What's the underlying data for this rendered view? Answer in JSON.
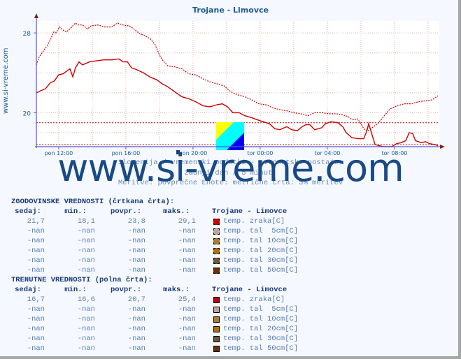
{
  "title": "Trojane - Limovce",
  "side_url": "www.si-vreme.com",
  "watermark": "www.si-vreme.com",
  "captions": [
    "Slovenija / vremenski podatki - avtomatske postaje.",
    "zadnji dan / 5 minut.",
    "Meritve: povprečne  Enote: metrične  Črta: 5% meritev"
  ],
  "chart_data": {
    "type": "line",
    "title": "Trojane - Limovce",
    "xlabel": "",
    "ylabel": "",
    "x_unit": "hours since pon 10:40",
    "xlim": [
      0,
      24
    ],
    "ylim": [
      16.6,
      29.2
    ],
    "yticks": [
      20,
      28
    ],
    "ytick_labels": [
      "20",
      "28"
    ],
    "xticks": [
      1.33,
      5.33,
      9.33,
      13.33,
      17.33,
      21.33
    ],
    "xtick_labels": [
      "pon 12:00",
      "pon 16:00",
      "pon 20:00",
      "tor 00:00",
      "tor 04:00",
      "tor 08:00"
    ],
    "grid": true,
    "reference_lines": [
      {
        "name": "historical max 5%",
        "y": 19.0
      },
      {
        "name": "current min",
        "y": 16.8
      }
    ],
    "series": [
      {
        "name": "temp. zraka[C] (zgodovinske, črtkana)",
        "style": "dashed",
        "color": "#cc0000",
        "x": [
          0,
          0.17,
          0.42,
          0.63,
          0.83,
          1.04,
          1.17,
          1.38,
          1.58,
          1.79,
          2.0,
          2.33,
          2.5,
          2.75,
          3.04,
          3.25,
          3.67,
          4.08,
          4.5,
          4.83,
          5.13,
          5.54,
          5.88,
          6.17,
          6.38,
          6.79,
          7.08,
          7.33,
          7.5,
          7.83,
          8.25,
          8.67,
          9.08,
          9.5,
          9.92,
          10.33,
          10.75,
          11.17,
          11.58,
          12.0,
          12.42,
          12.83,
          13.25,
          13.67,
          14.08,
          14.5,
          14.92,
          15.33,
          15.75,
          16.17,
          16.58,
          17.0,
          17.42,
          17.83,
          18.25,
          18.58,
          18.71,
          18.92,
          19.13,
          19.33,
          19.54,
          19.79,
          20.0,
          20.33,
          20.67,
          21.08,
          21.5,
          21.92,
          22.33,
          22.75,
          23.17,
          23.58,
          23.92
        ],
        "y": [
          24.8,
          25.6,
          26.2,
          26.7,
          27.3,
          28.1,
          28.0,
          28.6,
          28.3,
          28.1,
          28.4,
          29.0,
          28.8,
          28.8,
          28.4,
          28.7,
          28.8,
          28.6,
          28.6,
          29.0,
          28.8,
          28.7,
          28.3,
          27.9,
          27.8,
          27.4,
          26.8,
          25.8,
          25.3,
          24.7,
          24.6,
          24.4,
          23.9,
          23.8,
          23.4,
          23.1,
          22.9,
          22.7,
          22.1,
          21.8,
          21.6,
          21.3,
          20.9,
          20.8,
          20.5,
          20.3,
          20.2,
          20.0,
          19.9,
          19.7,
          20.0,
          20.0,
          19.9,
          19.9,
          19.8,
          19.6,
          19.4,
          19.3,
          19.4,
          18.9,
          18.3,
          18.2,
          18.5,
          18.9,
          19.6,
          20.4,
          20.7,
          20.9,
          20.9,
          21.1,
          21.2,
          21.3,
          21.7
        ]
      },
      {
        "name": "temp. zraka[C] (trenutne, polna)",
        "style": "solid",
        "color": "#cc0000",
        "x": [
          0,
          0.25,
          0.54,
          0.83,
          1.08,
          1.33,
          1.58,
          1.83,
          2.0,
          2.17,
          2.33,
          2.54,
          2.75,
          3.17,
          3.58,
          4.0,
          4.5,
          4.92,
          5.17,
          5.42,
          5.67,
          6.0,
          6.38,
          6.75,
          7.17,
          7.5,
          7.83,
          8.33,
          8.67,
          9.08,
          9.5,
          9.92,
          10.33,
          10.75,
          11.08,
          11.38,
          11.71,
          12.08,
          12.42,
          12.83,
          13.33,
          13.88,
          14.21,
          14.5,
          14.92,
          15.21,
          15.54,
          15.83,
          16.04,
          16.29,
          16.58,
          17.0,
          17.21,
          17.54,
          17.96,
          18.25,
          18.46,
          18.79,
          19.17,
          19.5,
          19.71,
          19.79,
          19.96,
          20.17,
          20.67,
          21.17,
          21.46,
          21.71,
          22.0,
          22.21,
          22.42,
          22.58,
          22.92,
          23.17,
          23.42,
          23.75,
          23.92
        ],
        "y": [
          22.0,
          22.2,
          22.4,
          23.0,
          23.2,
          23.8,
          23.9,
          24.2,
          24.4,
          23.6,
          24.5,
          25.1,
          24.8,
          25.1,
          25.2,
          25.3,
          25.3,
          25.4,
          25.1,
          25.1,
          24.5,
          24.3,
          24.0,
          23.6,
          23.3,
          22.9,
          22.6,
          22.0,
          21.6,
          21.4,
          21.1,
          20.7,
          20.6,
          20.8,
          20.9,
          20.6,
          20.0,
          20.0,
          19.7,
          19.5,
          19.2,
          18.9,
          18.4,
          18.3,
          18.6,
          18.3,
          18.2,
          18.6,
          18.8,
          18.8,
          18.3,
          18.5,
          18.9,
          19.1,
          19.0,
          18.6,
          18.0,
          17.5,
          17.4,
          17.4,
          18.3,
          18.9,
          18.0,
          16.8,
          16.6,
          16.6,
          16.9,
          17.0,
          17.2,
          18.0,
          17.9,
          17.2,
          17.0,
          17.1,
          16.9,
          16.8,
          16.7
        ]
      }
    ]
  },
  "historical": {
    "header": "ZGODOVINSKE VREDNOSTI (črtkana črta):",
    "columns": [
      "sedaj:",
      "min.:",
      "povpr.:",
      "maks.:"
    ],
    "station": "Trojane - Limovce",
    "rows": [
      {
        "values": [
          "21,7",
          "18,1",
          "23,8",
          "29,1"
        ],
        "label": "temp. zraka[C]",
        "color": "#cc0000"
      },
      {
        "values": [
          "-nan",
          "-nan",
          "-nan",
          "-nan"
        ],
        "label": "temp. tal  5cm[C]",
        "color": "#c0a0a0"
      },
      {
        "values": [
          "-nan",
          "-nan",
          "-nan",
          "-nan"
        ],
        "label": "temp. tal 10cm[C]",
        "color": "#b07830"
      },
      {
        "values": [
          "-nan",
          "-nan",
          "-nan",
          "-nan"
        ],
        "label": "temp. tal 20cm[C]",
        "color": "#b07000"
      },
      {
        "values": [
          "-nan",
          "-nan",
          "-nan",
          "-nan"
        ],
        "label": "temp. tal 30cm[C]",
        "color": "#6a5a3a"
      },
      {
        "values": [
          "-nan",
          "-nan",
          "-nan",
          "-nan"
        ],
        "label": "temp. tal 50cm[C]",
        "color": "#6a3000"
      }
    ]
  },
  "current": {
    "header": "TRENUTNE VREDNOSTI (polna črta):",
    "columns": [
      "sedaj:",
      "min.:",
      "povpr.:",
      "maks.:"
    ],
    "station": "Trojane - Limovce",
    "rows": [
      {
        "values": [
          "16,7",
          "16,6",
          "20,7",
          "25,4"
        ],
        "label": "temp. zraka[C]",
        "color": "#cc0000"
      },
      {
        "values": [
          "-nan",
          "-nan",
          "-nan",
          "-nan"
        ],
        "label": "temp. tal  5cm[C]",
        "color": "#c0a0a0"
      },
      {
        "values": [
          "-nan",
          "-nan",
          "-nan",
          "-nan"
        ],
        "label": "temp. tal 10cm[C]",
        "color": "#b07830"
      },
      {
        "values": [
          "-nan",
          "-nan",
          "-nan",
          "-nan"
        ],
        "label": "temp. tal 20cm[C]",
        "color": "#b07000"
      },
      {
        "values": [
          "-nan",
          "-nan",
          "-nan",
          "-nan"
        ],
        "label": "temp. tal 30cm[C]",
        "color": "#6a5a3a"
      },
      {
        "values": [
          "-nan",
          "-nan",
          "-nan",
          "-nan"
        ],
        "label": "temp. tal 50cm[C]",
        "color": "#6a3000"
      }
    ]
  }
}
